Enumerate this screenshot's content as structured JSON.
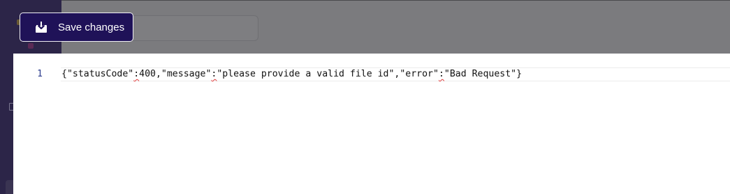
{
  "toolbar": {
    "save_label": "Save changes",
    "save_icon": "download-tray-icon"
  },
  "search": {
    "value": "",
    "placeholder": ""
  },
  "editor": {
    "line_number": "1",
    "tokens": [
      "{\"statusCode\"",
      ":",
      "400,\"message\"",
      ":",
      "\"please provide a valid file id\",\"error\"",
      ":",
      "\"Bad Request\"}"
    ]
  },
  "colors": {
    "accent": "#1f1258",
    "sidebar": "#2c2548",
    "overlay": "#7b7b7e",
    "line_number": "#2a3a8c",
    "lint_squiggle": "#e03a3a"
  }
}
